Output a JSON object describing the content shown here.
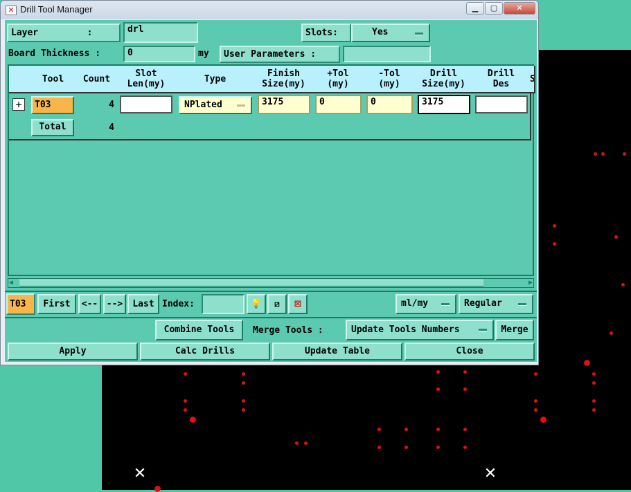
{
  "window": {
    "title": "Drill Tool Manager",
    "min_icon": "minimize-icon",
    "max_icon": "maximize-icon",
    "close_icon": "close-icon"
  },
  "top": {
    "layer_label": "Layer         :",
    "layer_value": "drl",
    "slots_label": "Slots:",
    "slots_value": "Yes",
    "board_thickness_label": "Board Thickness :",
    "board_thickness_value": "0",
    "board_thickness_unit": "my",
    "user_params_label": "User Parameters :",
    "user_params_value": ""
  },
  "table": {
    "headers": [
      "",
      "Tool",
      "Count",
      "Slot\nLen(my)",
      "Type",
      "Finish\nSize(my)",
      "+Tol\n(my)",
      "-Tol\n(my)",
      "Drill\nSize(my)",
      "Drill\nDes",
      "S"
    ],
    "rows": [
      {
        "tool": "T03",
        "count": "4",
        "slot_len": "",
        "type": "NPlated",
        "finish": "3175",
        "ptol": "0",
        "mtol": "0",
        "drill": "3175",
        "des": ""
      }
    ],
    "total_label": "Total",
    "total_count": "4"
  },
  "nav": {
    "current": "T03",
    "first": "First",
    "prev": "<--",
    "next": "-->",
    "last": "Last",
    "index_label": "Index:",
    "index_value": "",
    "units": "ml/my",
    "mode": "Regular"
  },
  "tools": {
    "combine": "Combine Tools",
    "merge_label": "Merge Tools :",
    "update_numbers": "Update Tools Numbers",
    "merge": "Merge"
  },
  "actions": {
    "apply": "Apply",
    "calc": "Calc Drills",
    "update": "Update Table",
    "close": "Close"
  },
  "colors": {
    "panel": "#5ccab0",
    "header": "#b8f0fc",
    "tool_cell": "#f7b54a",
    "canvas": "#000000",
    "drill_dot": "#e01010"
  }
}
